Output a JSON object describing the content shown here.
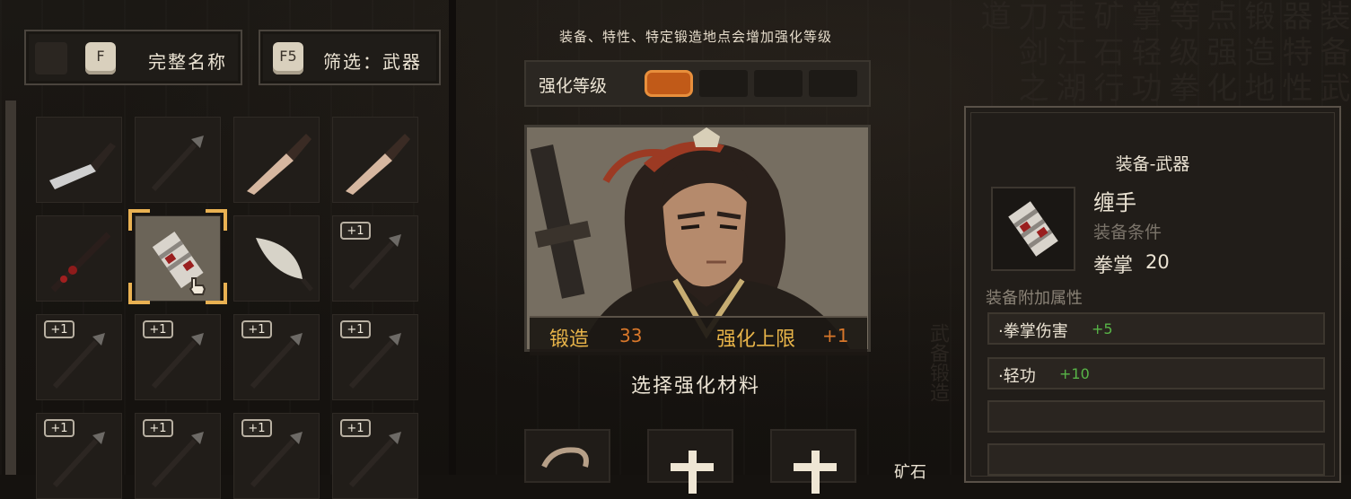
{
  "top_buttons": {
    "fullname": {
      "key": "F",
      "label": "完整名称"
    },
    "filter": {
      "key": "F5",
      "label": "筛选：武器"
    }
  },
  "inventory": {
    "slots": [
      {
        "icon": "cleaver-icon",
        "badge": ""
      },
      {
        "icon": "spear-icon",
        "badge": ""
      },
      {
        "icon": "dagger-icon",
        "badge": ""
      },
      {
        "icon": "dagger-icon",
        "badge": ""
      },
      {
        "icon": "flute-icon",
        "badge": ""
      },
      {
        "icon": "hand-wrap-icon",
        "badge": ""
      },
      {
        "icon": "fan-blade-icon",
        "badge": ""
      },
      {
        "icon": "spear-icon",
        "badge": "+1"
      },
      {
        "icon": "spear-icon",
        "badge": "+1"
      },
      {
        "icon": "spear-icon",
        "badge": "+1"
      },
      {
        "icon": "spear-icon",
        "badge": "+1"
      },
      {
        "icon": "spear-icon",
        "badge": "+1"
      },
      {
        "icon": "spear-icon",
        "badge": "+1"
      },
      {
        "icon": "spear-icon",
        "badge": "+1"
      },
      {
        "icon": "spear-icon",
        "badge": "+1"
      },
      {
        "icon": "spear-icon",
        "badge": "+1"
      }
    ],
    "selected_index": 5
  },
  "enhance": {
    "hint": "装备、特性、特定锻造地点会增加强化等级",
    "level_label": "强化等级",
    "level_filled": 1,
    "level_total": 4,
    "forge_label": "锻造",
    "forge_value": "33",
    "cap_label": "强化上限",
    "cap_value": "+1",
    "choose_material": "选择强化材料",
    "ore_label": "矿石"
  },
  "detail": {
    "category": "装备-武器",
    "name": "缠手",
    "req_label": "装备条件",
    "req_stat": "拳掌",
    "req_value": "20",
    "attr_header": "装备附加属性",
    "attrs": [
      {
        "name": "·拳掌伤害",
        "value": "+5"
      },
      {
        "name": "·轻功",
        "value": "+10"
      },
      {
        "name": "",
        "value": ""
      },
      {
        "name": "",
        "value": ""
      }
    ]
  },
  "colors": {
    "accent_orange": "#d8772a",
    "gold_label": "#e8b449",
    "bonus_green": "#58b547",
    "selection_gold": "#e9b152"
  }
}
